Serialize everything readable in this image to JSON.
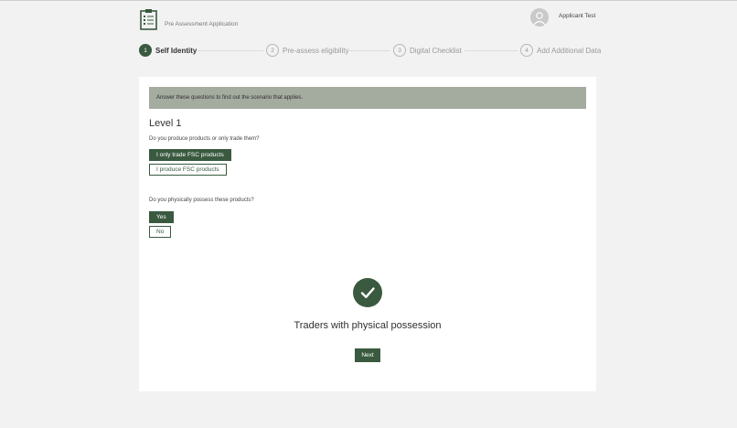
{
  "header": {
    "app_title": "Pre Assessment Application",
    "user_name": "Applicant Test"
  },
  "stepper": {
    "steps": [
      {
        "number": "1",
        "label": "Self Identity",
        "active": true
      },
      {
        "number": "2",
        "label": "Pre-assess eligibility",
        "active": false
      },
      {
        "number": "3",
        "label": "Digital Checklist",
        "active": false
      },
      {
        "number": "4",
        "label": "Add Additional Data",
        "active": false
      }
    ]
  },
  "main": {
    "banner": "Answer these questions to find out the scenario that applies.",
    "level_title": "Level 1",
    "question1": {
      "text": "Do you produce products or only trade them?",
      "options": [
        "I only trade FSC products",
        "I produce FSC products"
      ],
      "selected": "I only trade FSC products"
    },
    "question2": {
      "text": "Do you physically possess these products?",
      "options": [
        "Yes",
        "No"
      ],
      "selected": "Yes"
    },
    "result": {
      "icon": "check-circle-icon",
      "text": "Traders with physical possession"
    },
    "next_label": "Next"
  },
  "colors": {
    "accent": "#3a5a40",
    "banner": "#a4ab9f",
    "background": "#f2f2f2"
  }
}
